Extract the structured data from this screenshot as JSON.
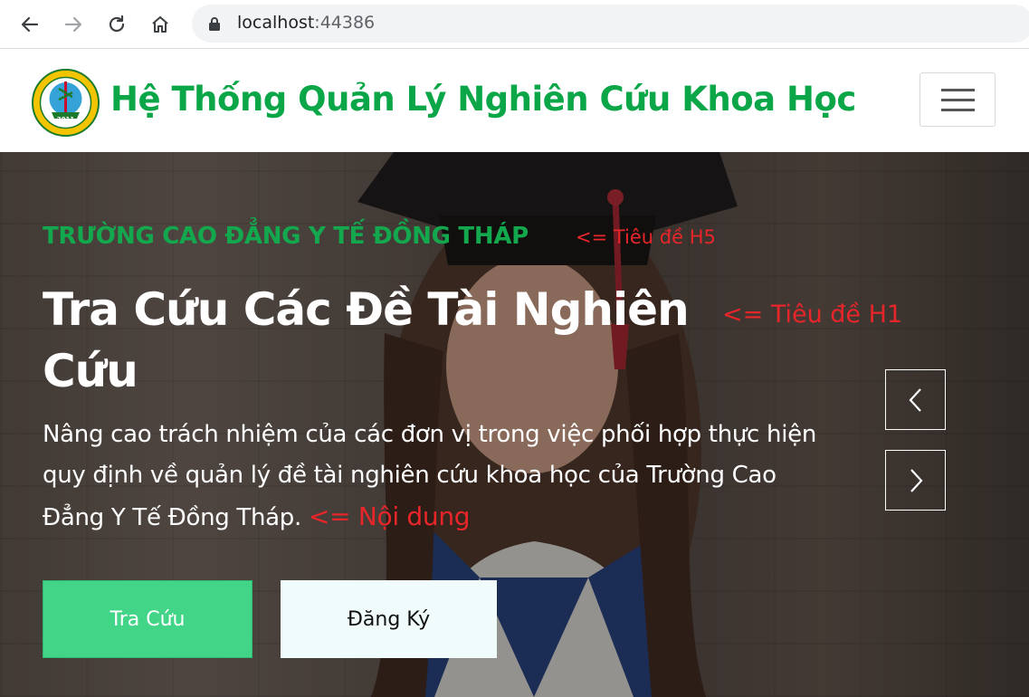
{
  "browser": {
    "url_host": "localhost",
    "url_port": ":44386",
    "icons": [
      "back-icon",
      "forward-icon",
      "reload-icon",
      "home-icon",
      "lock-icon"
    ]
  },
  "navbar": {
    "brand": "Hệ Thống Quản Lý Nghiên Cứu Khoa Học",
    "logo_year": "2011",
    "brand_color": "#0aa648"
  },
  "hero": {
    "h5_title": "TRƯỜNG CAO ĐẲNG Y TẾ ĐỒNG THÁP",
    "h5_note": "<= Tiêu đề H5",
    "h1_title": "Tra Cứu Các Đề Tài Nghiên Cứu",
    "h1_note": "<= Tiêu đề H1",
    "content": "Nâng cao trách nhiệm của các đơn vị trong việc phối hợp thực hiện quy định về quản lý đề tài nghiên cứu khoa học của Trường Cao Đẳng Y Tế Đồng Tháp.",
    "content_note": "<= Nội dung",
    "search_button": "Tra Cứu",
    "register_button": "Đăng Ký",
    "accent_color": "#42d487",
    "note_color": "#e8262a"
  }
}
